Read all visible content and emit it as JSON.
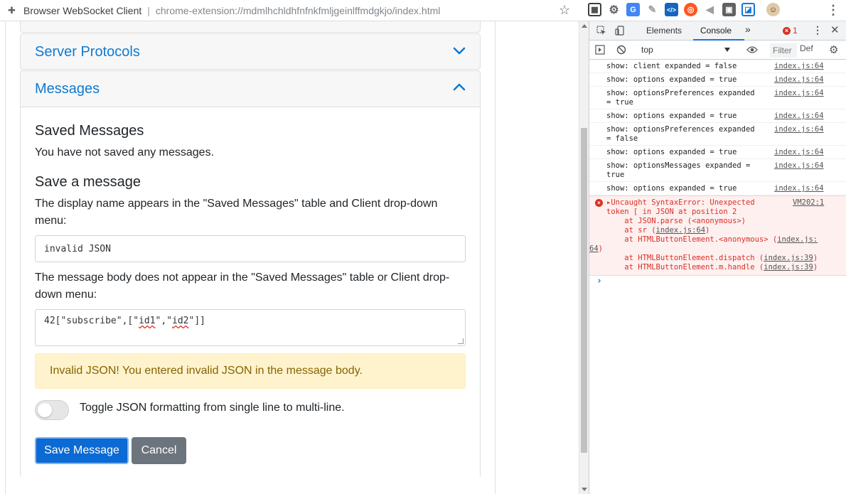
{
  "browser": {
    "page_title": "Browser WebSocket Client",
    "separator": "|",
    "url": "chrome-extension://mdmlhchldhfnfnkfmljgeinlffmdgkjo/index.html",
    "extension_colors": [
      "#3c4043",
      "#5f6368",
      "#4285f4",
      "#9e9e9e",
      "#1565c0",
      "#ff5722",
      "#9e9e9e",
      "#616161",
      "#1976d2"
    ]
  },
  "accordion": {
    "server_protocols_title": "Server Protocols",
    "messages_title": "Messages"
  },
  "messages": {
    "saved_heading": "Saved Messages",
    "no_saved_text": "You have not saved any messages.",
    "save_heading": "Save a message",
    "display_name_desc": "The display name appears in the \"Saved Messages\" table and Client drop-down menu:",
    "display_name_value": "invalid JSON",
    "body_desc": "The message body does not appear in the \"Saved Messages\" table or Client drop-down menu:",
    "body_value_prefix": "42[\"subscribe\",[\"",
    "body_value_id1": "id1",
    "body_value_mid": "\",\"",
    "body_value_id2": "id2",
    "body_value_suffix": "\"]]",
    "alert_text": "Invalid JSON! You entered invalid JSON in the message body.",
    "toggle_label": "Toggle JSON formatting from single line to multi-line.",
    "save_button": "Save Message",
    "cancel_button": "Cancel"
  },
  "devtools": {
    "tab_elements": "Elements",
    "tab_console": "Console",
    "more_tabs": "»",
    "error_count": "1",
    "context": "top",
    "filter_placeholder": "Filter",
    "default_levels": "Def",
    "logs": [
      {
        "text": "show: client expanded = false",
        "source": "index.js:64"
      },
      {
        "text": "show: options expanded = true",
        "source": "index.js:64"
      },
      {
        "text": "show: optionsPreferences expanded\n= true",
        "source": "index.js:64"
      },
      {
        "text": "show: options expanded = true",
        "source": "index.js:64"
      },
      {
        "text": "show: optionsPreferences expanded\n= false",
        "source": "index.js:64"
      },
      {
        "text": "show: options expanded = true",
        "source": "index.js:64"
      },
      {
        "text": "show: optionsMessages expanded =\ntrue",
        "source": "index.js:64"
      },
      {
        "text": "show: options expanded = true",
        "source": "index.js:64"
      }
    ],
    "error": {
      "line1": "Uncaught SyntaxError: Unexpected",
      "line2": "token [ in JSON at position 2",
      "line3": "    at JSON.parse (<anonymous>)",
      "line4_pre": "    at sr (",
      "line4_link": "index.js:64",
      "line4_post": ")",
      "line5_pre": "    at HTMLButtonElement.<anonymous> (",
      "line5_link": "index.js:",
      "line6_link": "64",
      "line6_post": ")",
      "line7_pre": "    at HTMLButtonElement.dispatch (",
      "line7_link": "index.js:39",
      "line7_post": ")",
      "line8_pre": "    at HTMLButtonElement.m.handle (",
      "line8_link": "index.js:39",
      "line8_post": ")",
      "source": "VM202:1"
    },
    "prompt": "›"
  }
}
